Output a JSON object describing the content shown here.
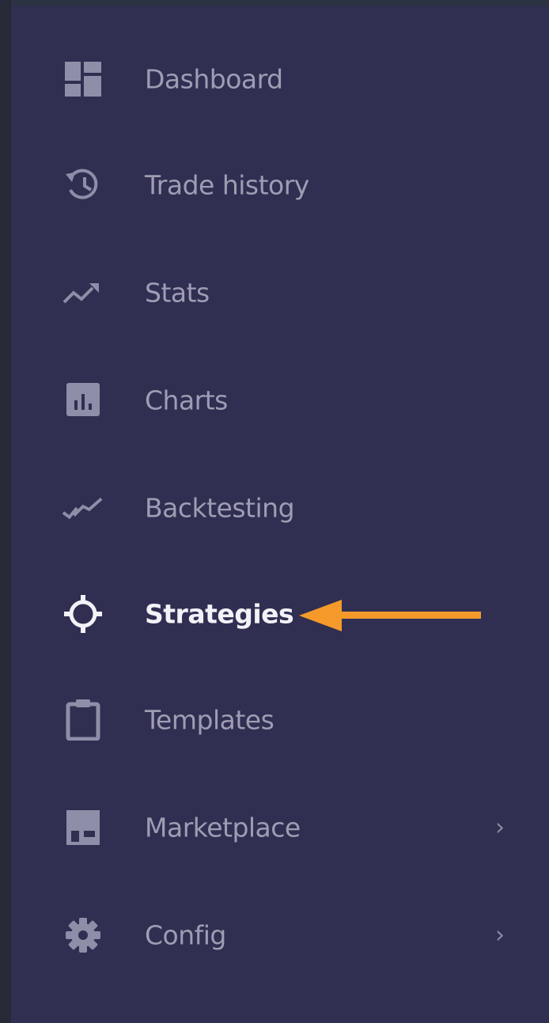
{
  "sidebar": {
    "items": [
      {
        "label": "Dashboard",
        "icon": "dashboard-icon",
        "active": false,
        "has_submenu": false
      },
      {
        "label": "Trade history",
        "icon": "history-icon",
        "active": false,
        "has_submenu": false
      },
      {
        "label": "Stats",
        "icon": "trend-icon",
        "active": false,
        "has_submenu": false
      },
      {
        "label": "Charts",
        "icon": "bar-chart-icon",
        "active": false,
        "has_submenu": false
      },
      {
        "label": "Backtesting",
        "icon": "backtest-icon",
        "active": false,
        "has_submenu": false
      },
      {
        "label": "Strategies",
        "icon": "crosshair-icon",
        "active": true,
        "has_submenu": false
      },
      {
        "label": "Templates",
        "icon": "clipboard-icon",
        "active": false,
        "has_submenu": false
      },
      {
        "label": "Marketplace",
        "icon": "store-icon",
        "active": false,
        "has_submenu": true
      },
      {
        "label": "Config",
        "icon": "gear-icon",
        "active": false,
        "has_submenu": true
      }
    ],
    "chevron_glyph": "›"
  },
  "annotation": {
    "arrow_color": "#f59a2a",
    "target": "Strategies"
  },
  "colors": {
    "sidebar_bg": "#302f52",
    "text_inactive": "#9e9db3",
    "text_active": "#f2f2f7",
    "icon_inactive": "#8f8ea8"
  }
}
